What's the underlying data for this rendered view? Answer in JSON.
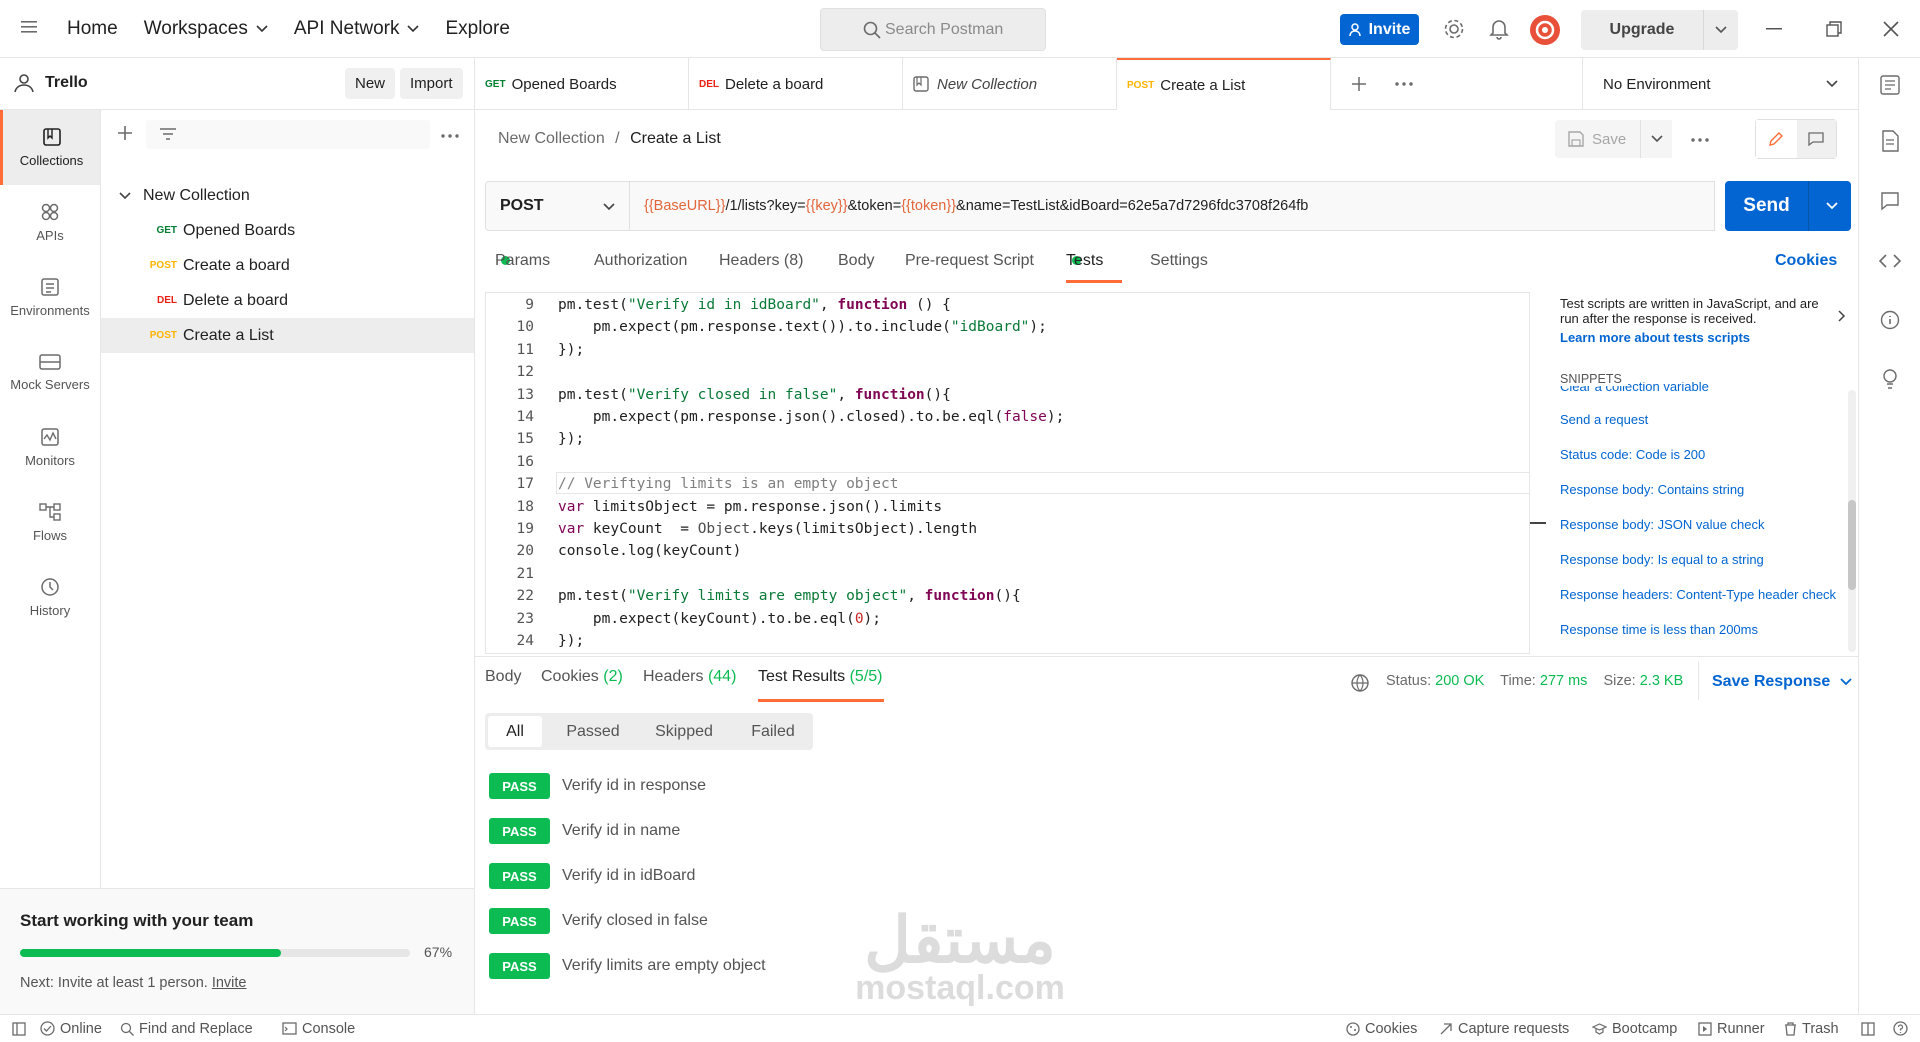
{
  "topbar": {
    "home": "Home",
    "workspaces": "Workspaces",
    "api_network": "API Network",
    "explore": "Explore",
    "search_placeholder": "Search Postman",
    "invite": "Invite",
    "upgrade": "Upgrade"
  },
  "workspace": {
    "name": "Trello",
    "new_label": "New",
    "import_label": "Import"
  },
  "rail": [
    {
      "label": "Collections",
      "icon": "collections-icon"
    },
    {
      "label": "APIs",
      "icon": "apis-icon"
    },
    {
      "label": "Environments",
      "icon": "environments-icon"
    },
    {
      "label": "Mock Servers",
      "icon": "mock-servers-icon"
    },
    {
      "label": "Monitors",
      "icon": "monitors-icon"
    },
    {
      "label": "Flows",
      "icon": "flows-icon"
    },
    {
      "label": "History",
      "icon": "history-icon"
    }
  ],
  "tree": {
    "collection": "New Collection",
    "items": [
      {
        "method": "GET",
        "name": "Opened Boards"
      },
      {
        "method": "POST",
        "name": "Create a board"
      },
      {
        "method": "DEL",
        "name": "Delete a board"
      },
      {
        "method": "POST",
        "name": "Create a List"
      }
    ]
  },
  "onboarding": {
    "title": "Start working with your team",
    "progress_percent": 67,
    "progress_label": "67%",
    "next_prefix": "Next: Invite at least 1 person.",
    "next_link": "Invite"
  },
  "tabs": [
    {
      "method": "GET",
      "name": "Opened Boards"
    },
    {
      "method": "DEL",
      "name": "Delete a board"
    },
    {
      "method": "",
      "name": "New Collection"
    },
    {
      "method": "POST",
      "name": "Create a List"
    }
  ],
  "environment": "No Environment",
  "breadcrumb": {
    "parent": "New Collection",
    "separator": "/",
    "current": "Create a List"
  },
  "save_label": "Save",
  "request": {
    "method": "POST",
    "url_parts": [
      {
        "text": "{{BaseURL}}",
        "var": true
      },
      {
        "text": "/1/lists?key=",
        "var": false
      },
      {
        "text": "{{key}}",
        "var": true
      },
      {
        "text": "&token=",
        "var": false
      },
      {
        "text": "{{token}}",
        "var": true
      },
      {
        "text": "&name=TestList&idBoard=62e5a7d7296fdc3708f264fb",
        "var": false
      }
    ],
    "send": "Send"
  },
  "req_tabs": {
    "params": "Params",
    "authorization": "Authorization",
    "headers": "Headers (8)",
    "body": "Body",
    "prerequest": "Pre-request Script",
    "tests": "Tests",
    "settings": "Settings",
    "cookies": "Cookies"
  },
  "code_lines": [
    {
      "n": "9",
      "html": "<span class=\"fn\">pm</span>.<span class=\"kw\" style=\"font-weight:normal;color:#212121\">test</span>(<span class=\"str\">\"Verify id in idBoard\"</span>, <span class=\"kw\">function</span> () {"
    },
    {
      "n": "10",
      "html": "    pm.expect(pm.response.text()).to.include(<span class=\"str\">\"idBoard\"</span>);"
    },
    {
      "n": "11",
      "html": "});"
    },
    {
      "n": "12",
      "html": ""
    },
    {
      "n": "13",
      "html": "pm.test(<span class=\"str\">\"Verify closed in false\"</span>, <span class=\"kw\">function</span>(){"
    },
    {
      "n": "14",
      "html": "    pm.expect(pm.response.json().closed).to.be.eql(<span class=\"kw\" style=\"font-weight:normal\">false</span>);"
    },
    {
      "n": "15",
      "html": "});"
    },
    {
      "n": "16",
      "html": ""
    },
    {
      "n": "17",
      "html": "<span class=\"cm\">// Veriftying limits is an empty object</span>"
    },
    {
      "n": "18",
      "html": "<span class=\"kw\" style=\"font-weight:normal\">var</span> limitsObject = pm.response.json().limits"
    },
    {
      "n": "19",
      "html": "<span class=\"kw\" style=\"font-weight:normal\">var</span> keyCount  = <span class=\"ob\">Object</span>.keys(limitsObject).length"
    },
    {
      "n": "20",
      "html": "console.log(keyCount)"
    },
    {
      "n": "21",
      "html": ""
    },
    {
      "n": "22",
      "html": "pm.test(<span class=\"str\">\"Verify limits are empty object\"</span>, <span class=\"kw\">function</span>(){"
    },
    {
      "n": "23",
      "html": "    pm.expect(keyCount).to.be.eql(<span class=\"num\">0</span>);"
    },
    {
      "n": "24",
      "html": "});"
    }
  ],
  "snippets": {
    "intro": "Test scripts are written in JavaScript, and are run after the response is received.",
    "learn": "Learn more about tests scripts",
    "heading": "SNIPPETS",
    "items": [
      "Clear a collection variable",
      "Send a request",
      "Status code: Code is 200",
      "Response body: Contains string",
      "Response body: JSON value check",
      "Response body: Is equal to a string",
      "Response headers: Content-Type header check",
      "Response time is less than 200ms"
    ]
  },
  "response": {
    "body": "Body",
    "cookies": "Cookies",
    "cookies_count": "(2)",
    "headers": "Headers",
    "headers_count": "(44)",
    "tests": "Test Results",
    "tests_count": "(5/5)",
    "status_label": "Status:",
    "status": "200 OK",
    "time_label": "Time:",
    "time": "277 ms",
    "size_label": "Size:",
    "size": "2.3 KB",
    "save": "Save Response"
  },
  "filters": [
    "All",
    "Passed",
    "Skipped",
    "Failed"
  ],
  "results": [
    {
      "badge": "PASS",
      "name": "Verify id in response"
    },
    {
      "badge": "PASS",
      "name": "Verify id in name"
    },
    {
      "badge": "PASS",
      "name": "Verify id in idBoard"
    },
    {
      "badge": "PASS",
      "name": "Verify closed in false"
    },
    {
      "badge": "PASS",
      "name": "Verify limits are empty object"
    }
  ],
  "watermark": {
    "arabic": "مستقل",
    "latin": "mostaql.com"
  },
  "bottom": {
    "online": "Online",
    "find": "Find and Replace",
    "console": "Console",
    "cookies": "Cookies",
    "capture": "Capture requests",
    "bootcamp": "Bootcamp",
    "runner": "Runner",
    "trash": "Trash"
  },
  "colors": {
    "accent": "#ff6c37",
    "primary": "#0265d2",
    "pass": "#0cbb52",
    "var": "#e2663b"
  }
}
